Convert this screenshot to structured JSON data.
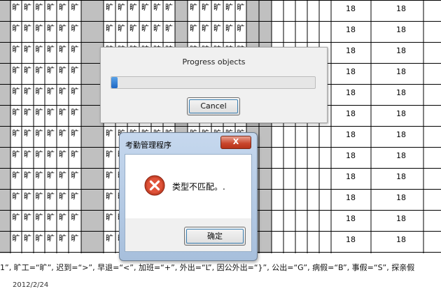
{
  "grid": {
    "cell_text": "旷",
    "total_value": "18",
    "rows": 12
  },
  "legend": {
    "text": "1”, 旷工=“旷”, 迟到=“>”, 早退=“<”, 加班=“+”, 外出=“L”, 因公外出=“}”, 公出=“G”, 病假=“B”, 事假=“S”, 探亲假"
  },
  "footer_date": "2012/2/24",
  "progress_dialog": {
    "title": "Progress objects",
    "progress": 0.03,
    "cancel_label": "Cancel"
  },
  "error_dialog": {
    "title": "考勤管理程序",
    "close_label": "X",
    "message": "类型不匹配。.",
    "ok_label": "确定"
  },
  "colors": {
    "gray_column": "#c0c0c0",
    "grid_line": "#000000",
    "progress_blue": "#1d67c4",
    "error_red": "#c8442a"
  }
}
